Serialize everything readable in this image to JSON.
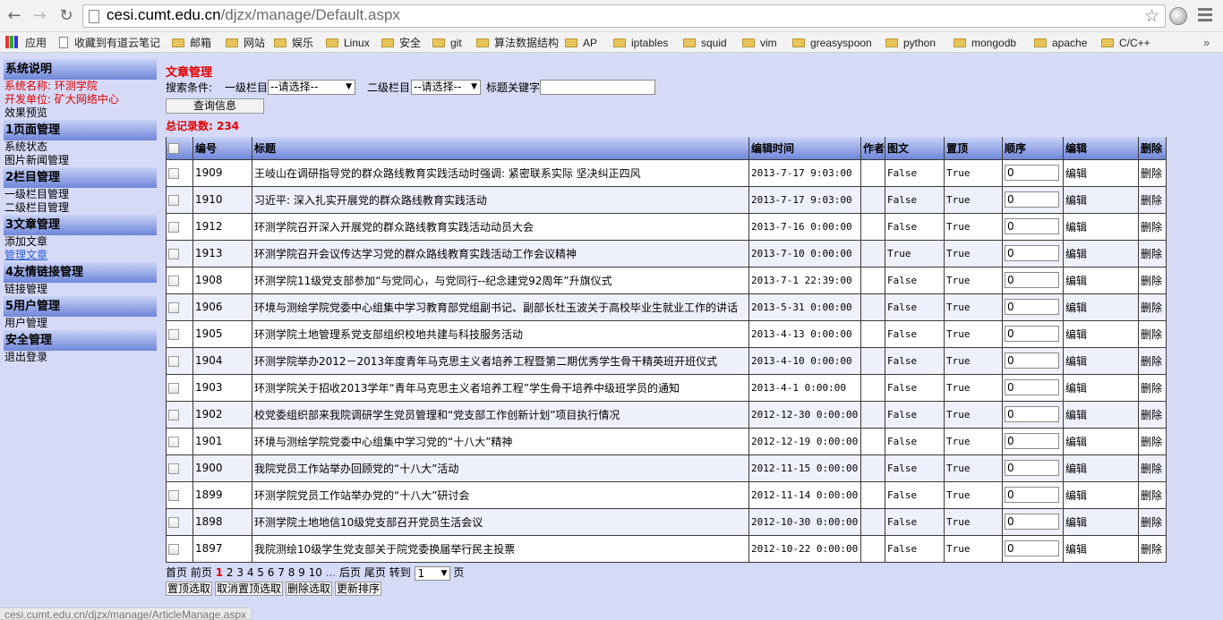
{
  "browser": {
    "url_host": "cesi.cumt.edu.cn",
    "url_path": "/djzx/manage/Default.aspx",
    "status_url": "cesi.cumt.edu.cn/djzx/manage/ArticleManage.aspx"
  },
  "bookmarks": [
    "应用",
    "收藏到有道云笔记",
    "邮箱",
    "网站",
    "娱乐",
    "Linux",
    "安全",
    "git",
    "算法数据结构",
    "AP",
    "iptables",
    "squid",
    "vim",
    "greasyspoon",
    "python",
    "mongodb",
    "apache",
    "C/C++"
  ],
  "sidebar": {
    "sections": [
      {
        "title": "系统说明",
        "items": [
          {
            "label": "系统名称: 环测学院",
            "style": "red"
          },
          {
            "label": "开发单位: 矿大网络中心",
            "style": "red"
          },
          {
            "label": "效果预览",
            "style": "normal"
          }
        ]
      },
      {
        "title": "1页面管理",
        "items": [
          {
            "label": "系统状态",
            "style": "normal"
          },
          {
            "label": "图片新闻管理",
            "style": "normal"
          }
        ]
      },
      {
        "title": "2栏目管理",
        "items": [
          {
            "label": "一级栏目管理",
            "style": "normal"
          },
          {
            "label": "二级栏目管理",
            "style": "normal"
          }
        ]
      },
      {
        "title": "3文章管理",
        "items": [
          {
            "label": "添加文章",
            "style": "normal"
          },
          {
            "label": "管理文章",
            "style": "link"
          }
        ]
      },
      {
        "title": "4友情链接管理",
        "items": [
          {
            "label": "链接管理",
            "style": "normal"
          }
        ]
      },
      {
        "title": "5用户管理",
        "items": [
          {
            "label": "用户管理",
            "style": "normal"
          }
        ]
      },
      {
        "title": "安全管理",
        "items": [
          {
            "label": "退出登录",
            "style": "normal"
          }
        ]
      }
    ]
  },
  "main": {
    "title": "文章管理",
    "search_label": "搜索条件:",
    "level1_label": "一级栏目",
    "level1_value": "--请选择--",
    "level2_label": "二级栏目",
    "level2_value": "--请选择--",
    "keyword_label": "标题关键字",
    "query_button": "查询信息",
    "total": "总记录数: 234"
  },
  "table": {
    "headers": [
      "编号",
      "标题",
      "编辑时间",
      "作者",
      "图文",
      "置顶",
      "顺序",
      "编辑",
      "删除"
    ],
    "rows": [
      {
        "id": "1909",
        "title": "王岐山在调研指导党的群众路线教育实践活动时强调: 紧密联系实际 坚决纠正四风",
        "time": "2013-7-17 9:03:00",
        "author": "",
        "pic": "False",
        "top": "True",
        "order": "0",
        "edit": "编辑",
        "del": "删除"
      },
      {
        "id": "1910",
        "title": "习近平: 深入扎实开展党的群众路线教育实践活动",
        "time": "2013-7-17 9:03:00",
        "author": "",
        "pic": "False",
        "top": "True",
        "order": "0",
        "edit": "编辑",
        "del": "删除"
      },
      {
        "id": "1912",
        "title": "环测学院召开深入开展党的群众路线教育实践活动动员大会",
        "time": "2013-7-16 0:00:00",
        "author": "",
        "pic": "False",
        "top": "True",
        "order": "0",
        "edit": "编辑",
        "del": "删除"
      },
      {
        "id": "1913",
        "title": "环测学院召开会议传达学习党的群众路线教育实践活动工作会议精神",
        "time": "2013-7-10 0:00:00",
        "author": "",
        "pic": "True",
        "top": "True",
        "order": "0",
        "edit": "编辑",
        "del": "删除"
      },
      {
        "id": "1908",
        "title": "环测学院11级党支部参加“与党同心，与党同行--纪念建党92周年”升旗仪式",
        "time": "2013-7-1 22:39:00",
        "author": "",
        "pic": "False",
        "top": "True",
        "order": "0",
        "edit": "编辑",
        "del": "删除"
      },
      {
        "id": "1906",
        "title": "环境与测绘学院党委中心组集中学习教育部党组副书记、副部长杜玉波关于高校毕业生就业工作的讲话",
        "time": "2013-5-31 0:00:00",
        "author": "",
        "pic": "False",
        "top": "True",
        "order": "0",
        "edit": "编辑",
        "del": "删除"
      },
      {
        "id": "1905",
        "title": "环测学院土地管理系党支部组织校地共建与科技服务活动",
        "time": "2013-4-13 0:00:00",
        "author": "",
        "pic": "False",
        "top": "True",
        "order": "0",
        "edit": "编辑",
        "del": "删除"
      },
      {
        "id": "1904",
        "title": "环测学院举办2012－2013年度青年马克思主义者培养工程暨第二期优秀学生骨干精英班开班仪式",
        "time": "2013-4-10 0:00:00",
        "author": "",
        "pic": "False",
        "top": "True",
        "order": "0",
        "edit": "编辑",
        "del": "删除"
      },
      {
        "id": "1903",
        "title": "环测学院关于招收2013学年“青年马克思主义者培养工程”学生骨干培养中级班学员的通知",
        "time": "2013-4-1 0:00:00",
        "author": "",
        "pic": "False",
        "top": "True",
        "order": "0",
        "edit": "编辑",
        "del": "删除"
      },
      {
        "id": "1902",
        "title": "校党委组织部来我院调研学生党员管理和“党支部工作创新计划”项目执行情况",
        "time": "2012-12-30 0:00:00",
        "author": "",
        "pic": "False",
        "top": "True",
        "order": "0",
        "edit": "编辑",
        "del": "删除"
      },
      {
        "id": "1901",
        "title": "环境与测绘学院党委中心组集中学习党的“十八大”精神",
        "time": "2012-12-19 0:00:00",
        "author": "",
        "pic": "False",
        "top": "True",
        "order": "0",
        "edit": "编辑",
        "del": "删除"
      },
      {
        "id": "1900",
        "title": "我院党员工作站举办回顾党的“十八大”活动",
        "time": "2012-11-15 0:00:00",
        "author": "",
        "pic": "False",
        "top": "True",
        "order": "0",
        "edit": "编辑",
        "del": "删除"
      },
      {
        "id": "1899",
        "title": "环测学院党员工作站举办党的“十八大”研讨会",
        "time": "2012-11-14 0:00:00",
        "author": "",
        "pic": "False",
        "top": "True",
        "order": "0",
        "edit": "编辑",
        "del": "删除"
      },
      {
        "id": "1898",
        "title": "环测学院土地地信10级党支部召开党员生活会议",
        "time": "2012-10-30 0:00:00",
        "author": "",
        "pic": "False",
        "top": "True",
        "order": "0",
        "edit": "编辑",
        "del": "删除"
      },
      {
        "id": "1897",
        "title": "我院测绘10级学生党支部关于院党委换届举行民主投票",
        "time": "2012-10-22 0:00:00",
        "author": "",
        "pic": "False",
        "top": "True",
        "order": "0",
        "edit": "编辑",
        "del": "删除"
      }
    ]
  },
  "pager": {
    "first": "首页",
    "prev": "前页",
    "current": "1",
    "pages": [
      "2",
      "3",
      "4",
      "5",
      "6",
      "7",
      "8",
      "9",
      "10"
    ],
    "ellipsis": "...",
    "next": "后页",
    "last": "尾页",
    "goto_label": "转到",
    "goto_value": "1",
    "goto_suffix": "页"
  },
  "actions": [
    "置顶选取",
    "取消置顶选取",
    "删除选取",
    "更新排序"
  ]
}
